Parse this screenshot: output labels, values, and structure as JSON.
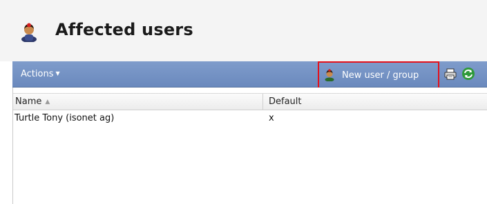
{
  "header": {
    "title": "Affected users",
    "icon": "user-icon"
  },
  "toolbar": {
    "actions_label": "Actions",
    "new_user_label": "New user / group",
    "icons": [
      "user-icon",
      "printer-icon",
      "refresh-icon"
    ],
    "highlight_color": "#e3101b",
    "bar_color": "#7390c2"
  },
  "grid": {
    "columns": [
      {
        "label": "Name",
        "sorted": "ascending"
      },
      {
        "label": "Default"
      }
    ],
    "rows": [
      {
        "name": "Turtle Tony (isonet ag)",
        "default": "x"
      }
    ]
  }
}
